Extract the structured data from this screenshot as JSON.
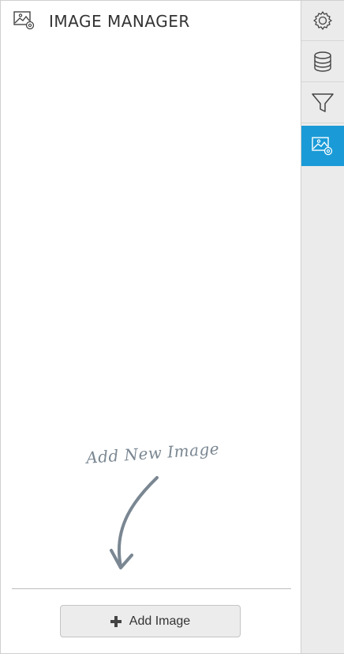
{
  "header": {
    "icon": "image-settings-icon",
    "title": "IMAGE MANAGER"
  },
  "hint": {
    "text": "Add New Image",
    "icon": "curved-arrow-down-icon"
  },
  "footer": {
    "add_button_label": "Add Image",
    "add_button_icon": "plus-icon"
  },
  "rail": {
    "items": [
      {
        "icon": "gear-icon",
        "active": false
      },
      {
        "icon": "database-icon",
        "active": false
      },
      {
        "icon": "filter-icon",
        "active": false
      },
      {
        "icon": "image-settings-icon",
        "active": true
      }
    ],
    "accent_color": "#1a9bd7"
  }
}
